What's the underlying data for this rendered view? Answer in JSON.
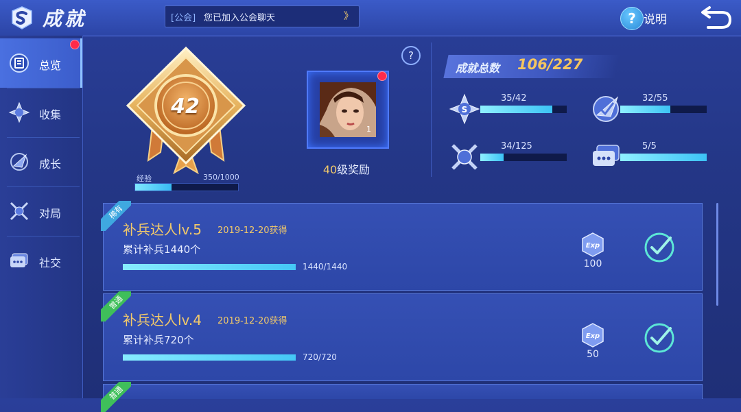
{
  "header": {
    "title": "成就",
    "notice_tag": "[公会]",
    "notice_text": "您已加入公会聊天",
    "notice_arrow": "》",
    "help_icon": "?",
    "help_label": "说明"
  },
  "sidebar": {
    "items": [
      {
        "label": "总览",
        "icon": "overview-icon",
        "active": true,
        "has_dot": true
      },
      {
        "label": "收集",
        "icon": "collection-icon"
      },
      {
        "label": "成长",
        "icon": "growth-icon"
      },
      {
        "label": "对局",
        "icon": "battle-icon"
      },
      {
        "label": "社交",
        "icon": "social-icon"
      }
    ]
  },
  "level": {
    "value": "42",
    "exp_label": "经验",
    "exp_text": "350/1000",
    "exp_fraction": 0.35
  },
  "reward": {
    "help": "?",
    "count": "1",
    "level_num": "40",
    "label": "级奖励"
  },
  "totals": {
    "label": "成就总数",
    "value": "106/227"
  },
  "stats": [
    {
      "icon": "collection-icon",
      "text": "35/42",
      "fraction": 0.833
    },
    {
      "icon": "growth-icon",
      "text": "32/55",
      "fraction": 0.582
    },
    {
      "icon": "battle-icon",
      "text": "34/125",
      "fraction": 0.272
    },
    {
      "icon": "social-icon",
      "text": "5/5",
      "fraction": 1.0
    }
  ],
  "achievements": [
    {
      "rarity": "稀有",
      "rarity_color": "#3fa8e0",
      "title": "补兵达人lv.5",
      "date": "2019-12-20获得",
      "desc": "累计补兵1440个",
      "progress": "1440/1440",
      "fraction": 1.0,
      "exp": "100"
    },
    {
      "rarity": "普通",
      "rarity_color": "#3fbf5a",
      "title": "补兵达人lv.4",
      "date": "2019-12-20获得",
      "desc": "累计补兵720个",
      "progress": "720/720",
      "fraction": 1.0,
      "exp": "50"
    },
    {
      "rarity": "普通",
      "rarity_color": "#3fbf5a"
    }
  ],
  "colors": {
    "accent_gold": "#f2c96a",
    "progress_cyan": "#44c8f6",
    "background": "#243787"
  }
}
